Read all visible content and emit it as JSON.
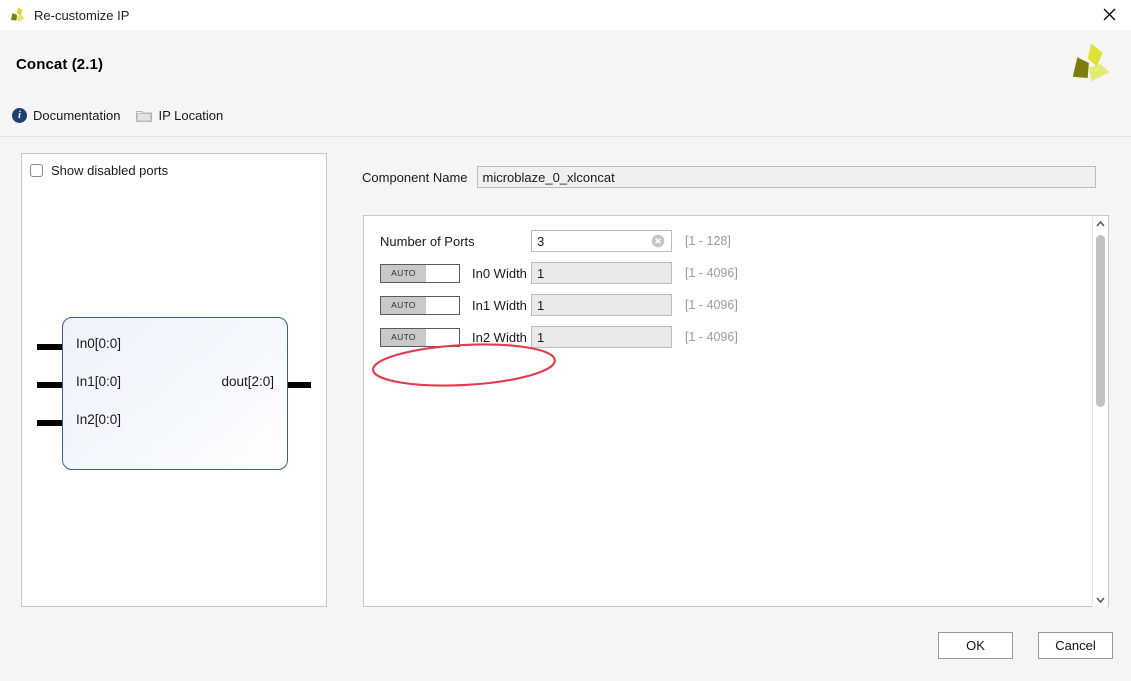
{
  "window": {
    "title": "Re-customize IP",
    "app_icon": "xilinx-logo-icon",
    "close_icon": "close-icon"
  },
  "header": {
    "title": "Concat (2.1)",
    "logo_icon": "xilinx-logo-icon",
    "links": [
      {
        "label": "Documentation",
        "icon": "info-icon"
      },
      {
        "label": "IP Location",
        "icon": "folder-icon"
      }
    ]
  },
  "preview": {
    "show_disabled_ports": {
      "label": "Show disabled ports",
      "checked": false
    },
    "block": {
      "inputs": [
        "In0[0:0]",
        "In1[0:0]",
        "In2[0:0]"
      ],
      "outputs": [
        "dout[2:0]"
      ]
    }
  },
  "config": {
    "component_name": {
      "label": "Component Name",
      "value": "microblaze_0_xlconcat"
    },
    "rows": [
      {
        "label": "Number of Ports",
        "value": "3",
        "range": "[1 - 128]",
        "has_auto": false,
        "auto_label": "",
        "editable": true,
        "has_clear": true,
        "clear_icon": "clear-circle-icon"
      },
      {
        "label": "In0 Width",
        "value": "1",
        "range": "[1 - 4096]",
        "has_auto": true,
        "auto_label": "AUTO",
        "editable": false,
        "has_clear": false,
        "clear_icon": ""
      },
      {
        "label": "In1 Width",
        "value": "1",
        "range": "[1 - 4096]",
        "has_auto": true,
        "auto_label": "AUTO",
        "editable": false,
        "has_clear": false,
        "clear_icon": ""
      },
      {
        "label": "In2 Width",
        "value": "1",
        "range": "[1 - 4096]",
        "has_auto": true,
        "auto_label": "AUTO",
        "editable": false,
        "has_clear": false,
        "clear_icon": ""
      }
    ],
    "scrollbar": {
      "up_icon": "chevron-up-icon",
      "down_icon": "chevron-down-icon"
    }
  },
  "annotation": {
    "shape": "ellipse",
    "color": "#e23b4c",
    "targets": "Number of Ports"
  },
  "footer": {
    "ok_label": "OK",
    "cancel_label": "Cancel"
  },
  "colors": {
    "accent_blue": "#3c5c94",
    "logo_green": "#d8dd3a",
    "logo_olive": "#7a7a10",
    "annotation_red": "#e23b4c",
    "panel_bg": "#f5f5f5"
  }
}
